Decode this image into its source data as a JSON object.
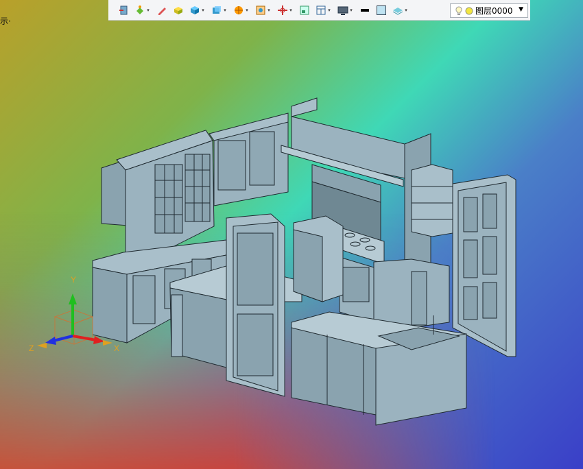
{
  "viewport": {
    "hint_text": "示·",
    "axis": {
      "y_label": "Y",
      "z_label": "Z",
      "x_label": "X"
    }
  },
  "toolbar": {
    "layer_label": "图层0000",
    "buttons": [
      "exit-icon",
      "paint-bucket-icon",
      "pencil-icon",
      "box-solid-icon",
      "cube-icon",
      "view-box-icon",
      "render-sphere-icon",
      "frame-icon",
      "pivot-icon",
      "panel-icon",
      "split-view-icon",
      "display-icon",
      "line-weight-icon",
      "fill-color-icon",
      "layer-stack-icon"
    ]
  },
  "colors": {
    "model_fill": "#9bb3bf",
    "model_shadow": "#7e96a3",
    "model_edge": "#1f2a30",
    "axis_x": "#e02020",
    "axis_y": "#1fbf1f",
    "axis_z": "#2030e0"
  }
}
